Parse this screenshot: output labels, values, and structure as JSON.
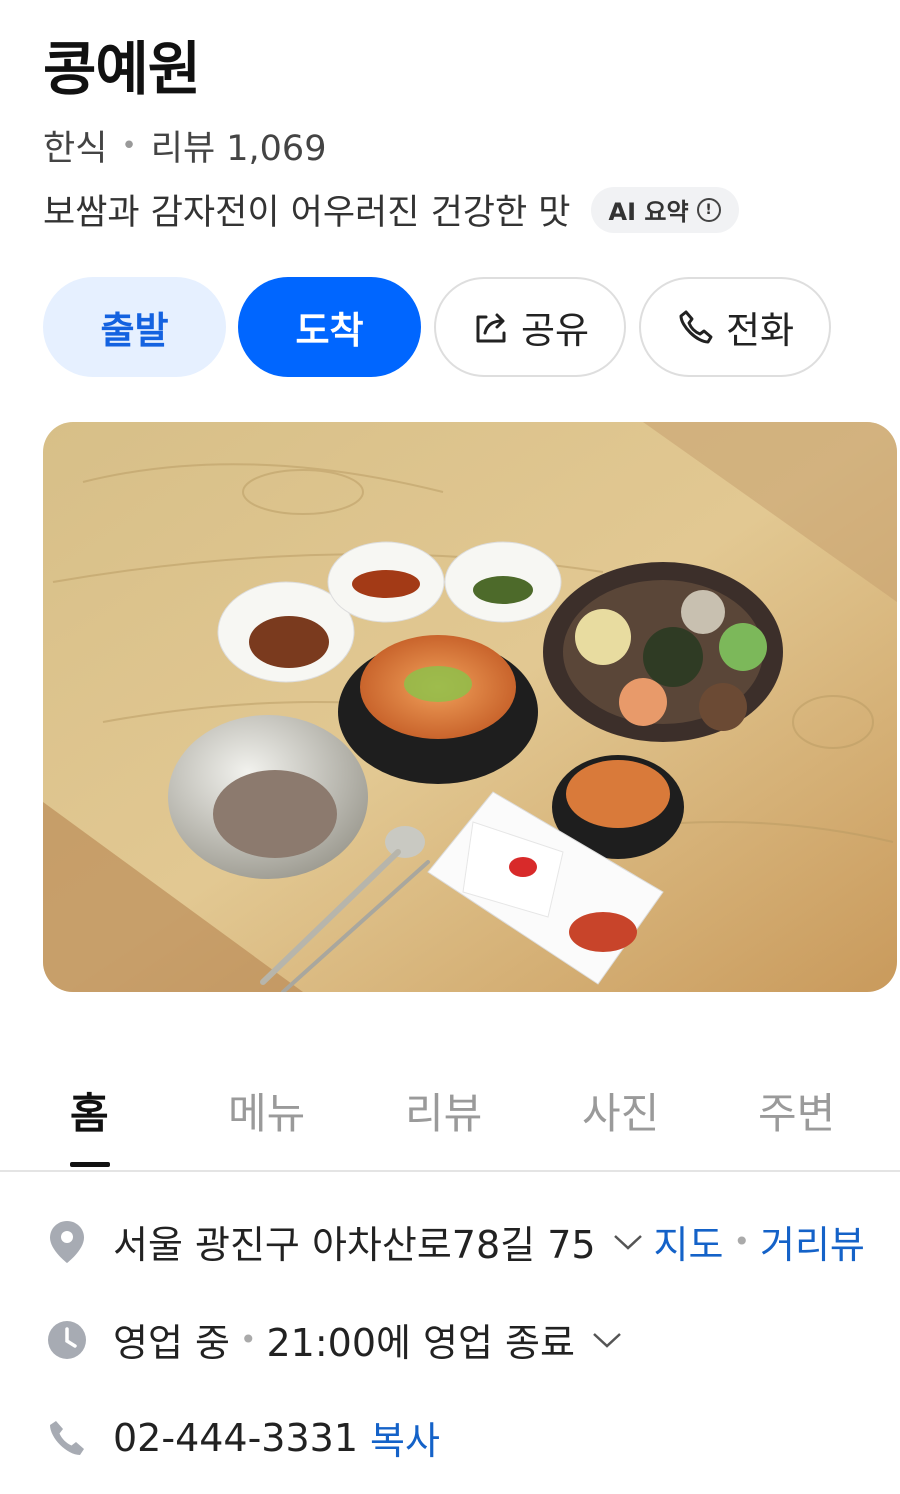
{
  "place": {
    "name": "콩예원",
    "category": "한식",
    "review_label": "리뷰 1,069",
    "summary": "보쌈과 감자전이 어우러진 건강한 맛",
    "ai_badge": "AI 요약"
  },
  "actions": {
    "start": "출발",
    "arrive": "도착",
    "share": "공유",
    "call": "전화"
  },
  "tabs": [
    "홈",
    "메뉴",
    "리뷰",
    "사진",
    "주변"
  ],
  "info": {
    "address": "서울 광진구 아차산로78길 75",
    "map_link": "지도",
    "street_view_link": "거리뷰",
    "status": "영업 중",
    "hours": "21:00에 영업 종료",
    "phone": "02-444-3331",
    "copy_label": "복사"
  },
  "colors": {
    "accent": "#0066ff",
    "link": "#1462c8",
    "icon_gray": "#a7abb3"
  }
}
